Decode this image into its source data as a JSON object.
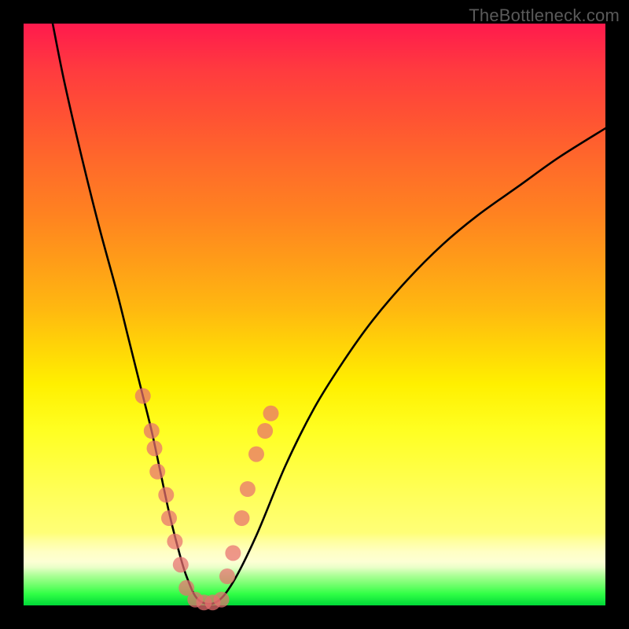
{
  "watermark": "TheBottleneck.com",
  "chart_data": {
    "type": "line",
    "title": "",
    "xlabel": "",
    "ylabel": "",
    "xlim": [
      0,
      100
    ],
    "ylim": [
      0,
      100
    ],
    "grid": false,
    "series": [
      {
        "name": "curve",
        "color": "#000000",
        "x": [
          5,
          7,
          10,
          13,
          16,
          18,
          20,
          22,
          23.5,
          25,
          26.5,
          28,
          30,
          33,
          36,
          40,
          45,
          50,
          55,
          60,
          66,
          72,
          78,
          85,
          92,
          100
        ],
        "y": [
          100,
          90,
          77,
          65,
          54,
          46,
          38,
          30,
          23,
          16,
          10,
          5,
          1,
          0.5,
          4,
          12,
          24,
          34,
          42,
          49,
          56,
          62,
          67,
          72,
          77,
          82
        ]
      }
    ],
    "markers": {
      "name": "markers",
      "color": "#e76f6f",
      "alpha": 0.72,
      "radius_px": 10,
      "points": [
        {
          "x": 20.5,
          "y": 36
        },
        {
          "x": 22.0,
          "y": 30
        },
        {
          "x": 22.5,
          "y": 27
        },
        {
          "x": 23.0,
          "y": 23
        },
        {
          "x": 24.5,
          "y": 19
        },
        {
          "x": 25.0,
          "y": 15
        },
        {
          "x": 26.0,
          "y": 11
        },
        {
          "x": 27.0,
          "y": 7
        },
        {
          "x": 28.0,
          "y": 3
        },
        {
          "x": 29.5,
          "y": 1
        },
        {
          "x": 31.0,
          "y": 0.5
        },
        {
          "x": 32.5,
          "y": 0.5
        },
        {
          "x": 34.0,
          "y": 1
        },
        {
          "x": 35.0,
          "y": 5
        },
        {
          "x": 36.0,
          "y": 9
        },
        {
          "x": 37.5,
          "y": 15
        },
        {
          "x": 38.5,
          "y": 20
        },
        {
          "x": 40.0,
          "y": 26
        },
        {
          "x": 41.5,
          "y": 30
        },
        {
          "x": 42.5,
          "y": 33
        }
      ]
    }
  }
}
